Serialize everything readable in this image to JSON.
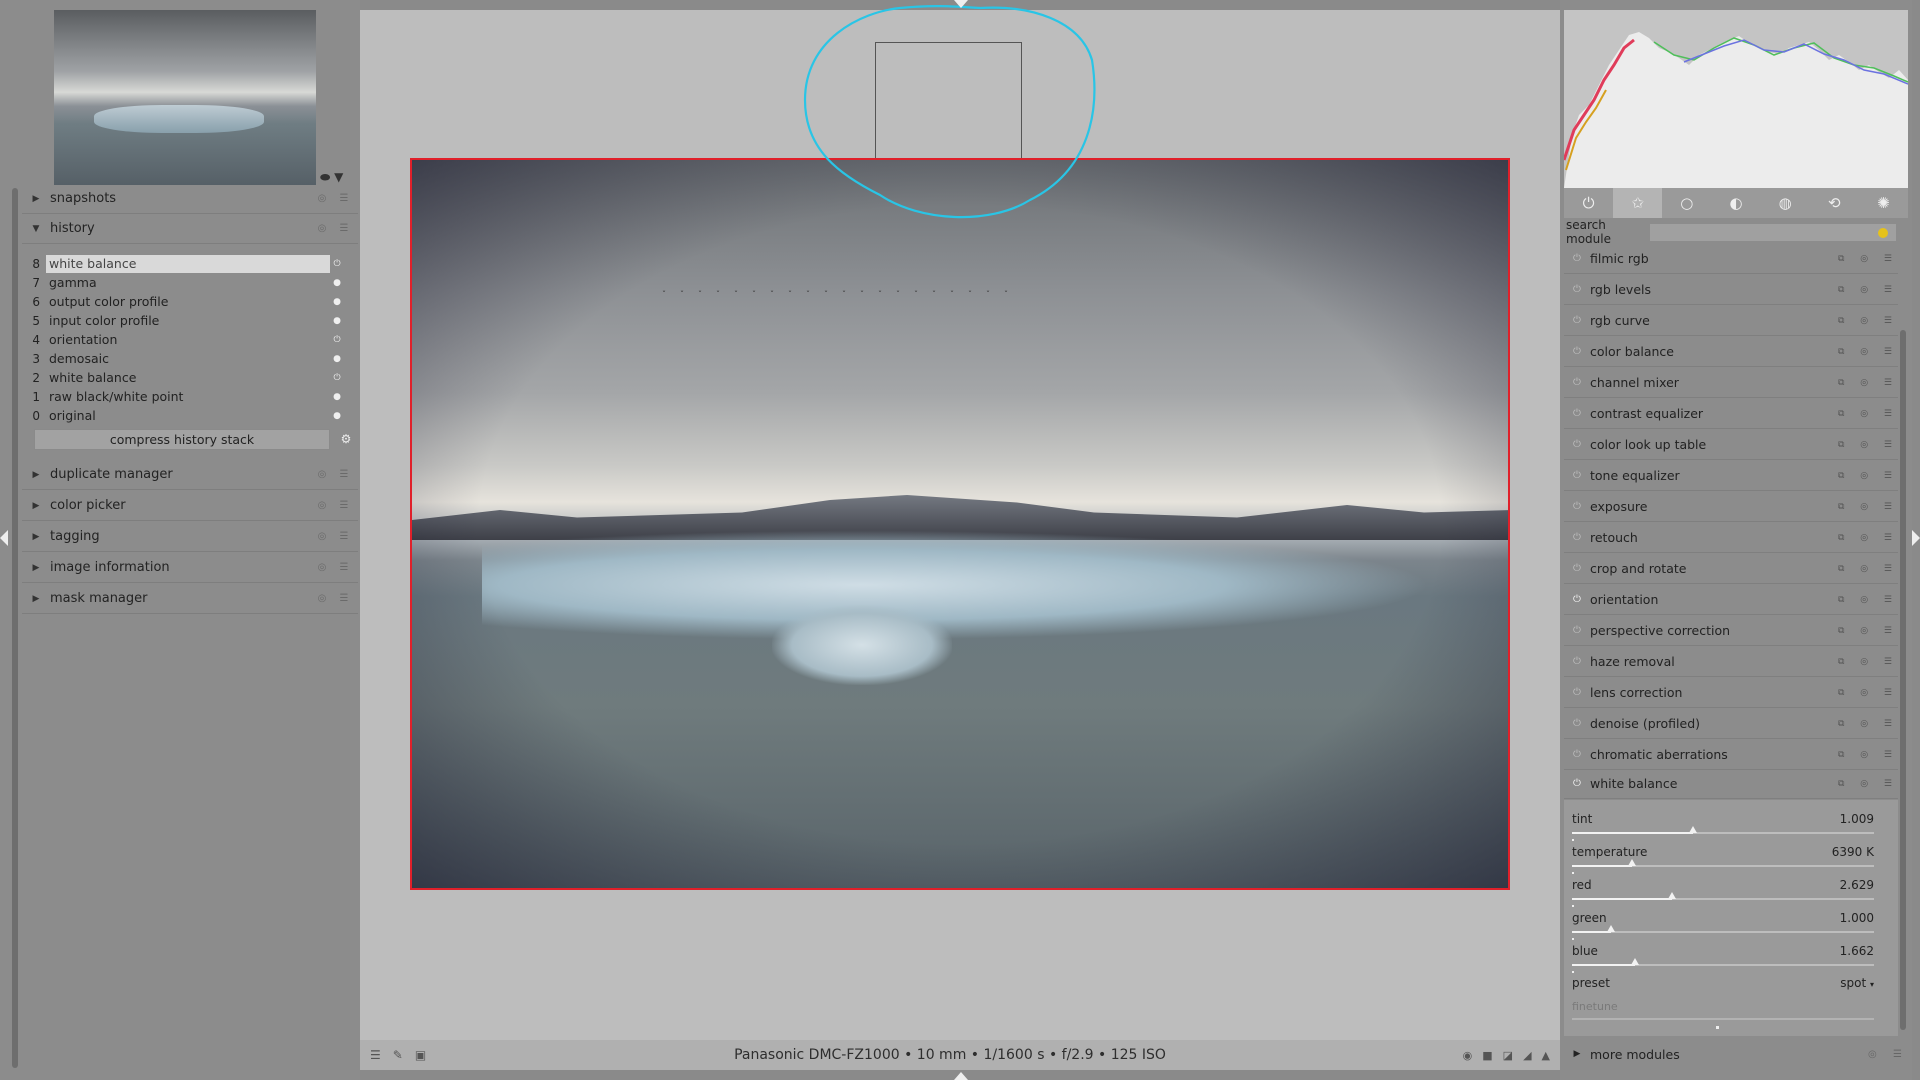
{
  "left_panel": {
    "sections": [
      {
        "label": "snapshots",
        "expanded": false
      },
      {
        "label": "history",
        "expanded": true
      },
      {
        "label": "duplicate manager",
        "expanded": false
      },
      {
        "label": "color picker",
        "expanded": false
      },
      {
        "label": "tagging",
        "expanded": false
      },
      {
        "label": "image information",
        "expanded": false
      },
      {
        "label": "mask manager",
        "expanded": false
      }
    ],
    "history": {
      "items": [
        {
          "num": "8",
          "label": "white balance",
          "active": true
        },
        {
          "num": "7",
          "label": "gamma"
        },
        {
          "num": "6",
          "label": "output color profile"
        },
        {
          "num": "5",
          "label": "input color profile"
        },
        {
          "num": "4",
          "label": "orientation"
        },
        {
          "num": "3",
          "label": "demosaic"
        },
        {
          "num": "2",
          "label": "white balance"
        },
        {
          "num": "1",
          "label": "raw black/white point"
        },
        {
          "num": "0",
          "label": "original"
        }
      ],
      "compress_label": "compress history stack"
    }
  },
  "center": {
    "exif": "Panasonic DMC-FZ1000  •  10 mm • 1/1600 s • f/2.9 • 125 ISO"
  },
  "right_panel": {
    "tabs": [
      "power-icon",
      "star-icon",
      "circle-icon",
      "tone-icon",
      "color-icon",
      "correct-icon",
      "effect-icon"
    ],
    "active_tab": 1,
    "search": {
      "label": "search module",
      "value": ""
    },
    "modules": [
      {
        "label": "filmic rgb",
        "on": false
      },
      {
        "label": "rgb levels",
        "on": false
      },
      {
        "label": "rgb curve",
        "on": false
      },
      {
        "label": "color balance",
        "on": false
      },
      {
        "label": "channel mixer",
        "on": false
      },
      {
        "label": "contrast equalizer",
        "on": false
      },
      {
        "label": "color look up table",
        "on": false
      },
      {
        "label": "tone equalizer",
        "on": false
      },
      {
        "label": "exposure",
        "on": false
      },
      {
        "label": "retouch",
        "on": false
      },
      {
        "label": "crop and rotate",
        "on": false
      },
      {
        "label": "orientation",
        "on": true
      },
      {
        "label": "perspective correction",
        "on": false
      },
      {
        "label": "haze removal",
        "on": false
      },
      {
        "label": "lens correction",
        "on": false
      },
      {
        "label": "denoise (profiled)",
        "on": false
      },
      {
        "label": "chromatic aberrations",
        "on": false
      },
      {
        "label": "white balance",
        "on": true
      }
    ],
    "white_balance": {
      "sliders": [
        {
          "name": "tint",
          "value": "1.009",
          "level": 0.4
        },
        {
          "name": "temperature",
          "value": "6390 K",
          "level": 0.2
        },
        {
          "name": "red",
          "value": "2.629",
          "level": 0.33
        },
        {
          "name": "green",
          "value": "1.000",
          "level": 0.13
        },
        {
          "name": "blue",
          "value": "1.662",
          "level": 0.21
        }
      ],
      "preset_label": "preset",
      "preset_value": "spot",
      "finetune_label": "finetune"
    },
    "more_modules": "more modules"
  },
  "colors": {
    "crop_frame": "#e0202a",
    "annotation": "#29c5e6",
    "panel_bg": "#8c8c8c",
    "center_bg": "#bdbdbd"
  }
}
